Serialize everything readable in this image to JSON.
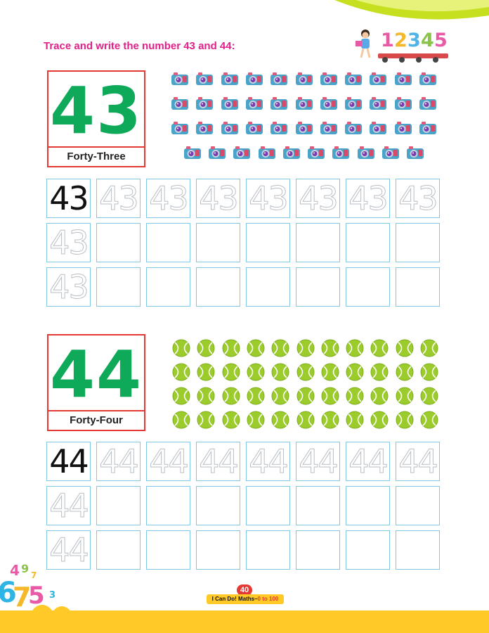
{
  "instruction": "Trace and write the number 43 and 44:",
  "train_digits": [
    "1",
    "2",
    "3",
    "4",
    "5"
  ],
  "train_colors": [
    "#e85aa6",
    "#f4b82a",
    "#4fb3e8",
    "#8bc34a",
    "#e85aa6"
  ],
  "sections": [
    {
      "number": "43",
      "word": "Forty-Three",
      "object": "camera",
      "object_count": 43,
      "object_rows": [
        11,
        11,
        11,
        10
      ],
      "practice_rows": [
        [
          "solid",
          "trace",
          "trace",
          "trace",
          "trace",
          "trace",
          "trace",
          "trace"
        ],
        [
          "trace",
          "empty",
          "empty",
          "empty",
          "empty",
          "empty",
          "empty",
          "empty"
        ],
        [
          "trace",
          "empty",
          "empty",
          "empty",
          "empty",
          "empty",
          "empty",
          "empty"
        ]
      ]
    },
    {
      "number": "44",
      "word": "Forty-Four",
      "object": "tennis-ball",
      "object_count": 44,
      "object_rows": [
        11,
        11,
        11,
        11
      ],
      "practice_rows": [
        [
          "solid",
          "trace",
          "trace",
          "trace",
          "trace",
          "trace",
          "trace",
          "trace"
        ],
        [
          "trace",
          "empty",
          "empty",
          "empty",
          "empty",
          "empty",
          "empty",
          "empty"
        ],
        [
          "trace",
          "empty",
          "empty",
          "empty",
          "empty",
          "empty",
          "empty",
          "empty"
        ]
      ]
    }
  ],
  "footer": {
    "page_number": "40",
    "book_title": "I Can Do! Maths–",
    "book_range": "0 to 100"
  },
  "colors": {
    "accent_pink": "#e0218a",
    "number_green": "#0fa95a",
    "box_red": "#e53935",
    "grid_blue": "#7ec8e3",
    "footer_yellow": "#ffc928",
    "swoosh_green": "#c6e01f"
  }
}
